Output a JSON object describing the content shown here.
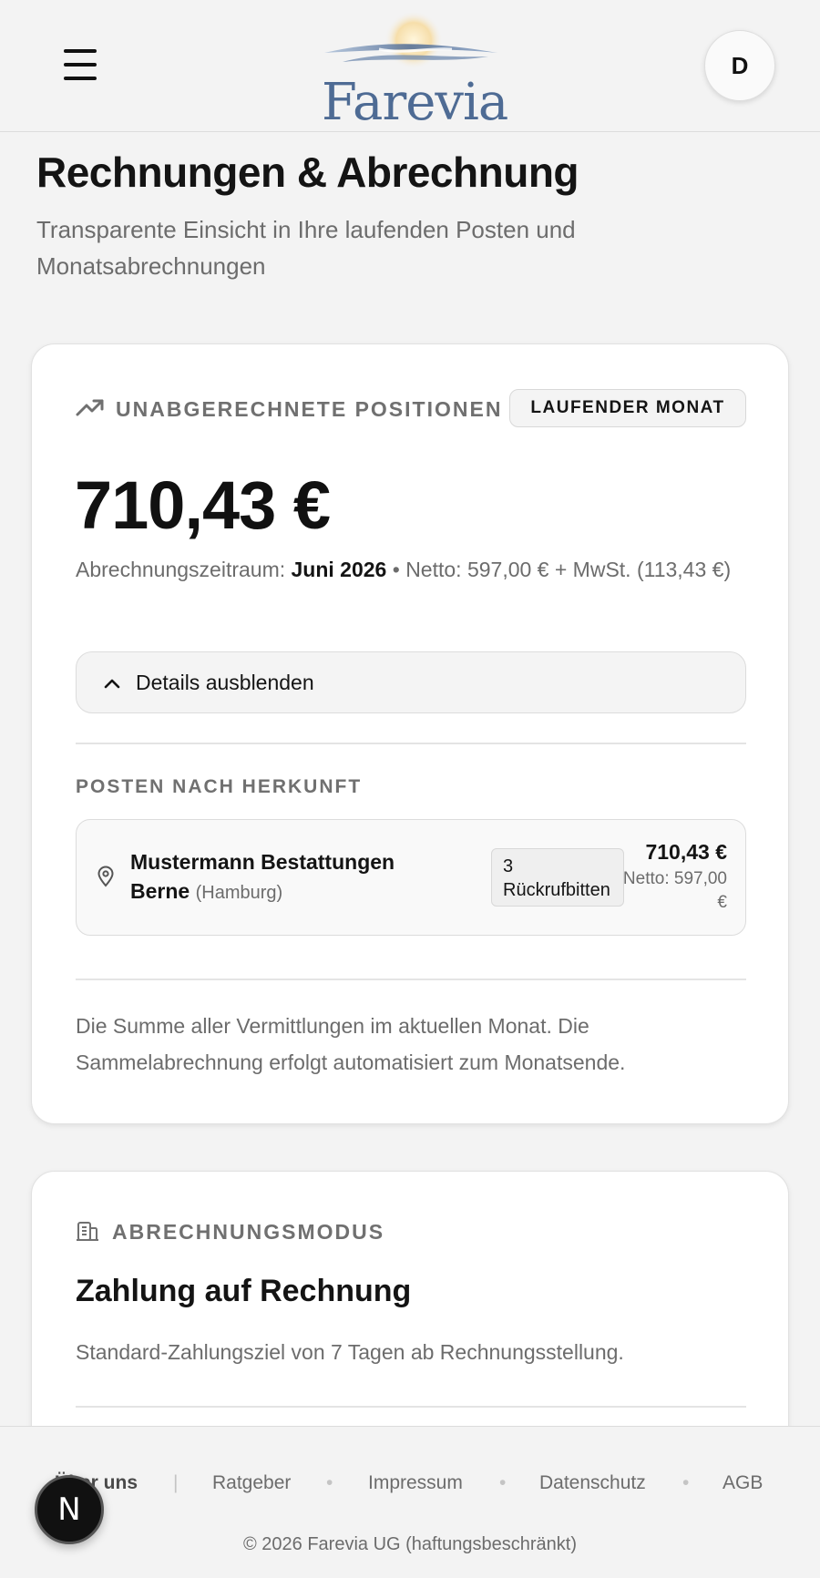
{
  "header": {
    "brand": "Farevia",
    "avatar_initial": "D"
  },
  "page": {
    "title": "Rechnungen & Abrechnung",
    "subtitle": "Transparente Einsicht in Ihre laufenden Posten und Monatsabrechnungen"
  },
  "unbilled": {
    "label": "UNABGERECHNETE POSITIONEN",
    "badge": "LAUFENDER MONAT",
    "amount": "710,43 €",
    "period_prefix": "Abrechnungszeitraum: ",
    "period_value": "Juni 2026",
    "period_suffix": " • Netto: 597,00 € + MwSt. (113,43 €)",
    "toggle_label": "Details ausblenden",
    "origin_label": "POSTEN NACH HERKUNFT",
    "origins": [
      {
        "name": "Mustermann Bestattungen Berne",
        "city": "(Hamburg)",
        "count": "3 Rückrufbitten",
        "amount": "710,43 €",
        "net": "Netto: 597,00 €"
      }
    ],
    "note": "Die Summe aller Vermittlungen im aktuellen Monat. Die Sammelabrechnung erfolgt automatisiert zum Monatsende."
  },
  "billing_mode": {
    "label": "ABRECHNUNGSMODUS",
    "title": "Zahlung auf Rechnung",
    "description": "Standard-Zahlungsziel von 7 Tagen ab Rechnungsstellung."
  },
  "footer": {
    "links": [
      "Über uns",
      "Ratgeber",
      "Impressum",
      "Datenschutz",
      "AGB"
    ],
    "copyright": "© 2026 Farevia UG (haftungsbeschränkt)"
  },
  "dev_badge": "N",
  "colors": {
    "brand_blue": "#4e6b94",
    "text_primary": "#141414",
    "text_muted": "#6c6c6c",
    "background": "#f3f3f3"
  }
}
